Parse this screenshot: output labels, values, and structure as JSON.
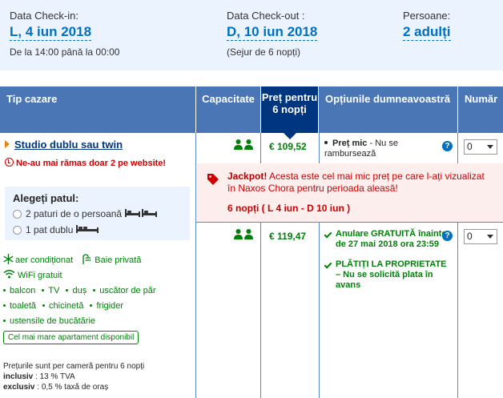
{
  "summary": {
    "checkin_label": "Data Check-in:",
    "checkin_value": "L, 4 iun 2018",
    "checkin_time": "De la 14:00 până la 00:00",
    "checkout_label": "Data Check-out :",
    "checkout_value": "D, 10 iun 2018",
    "stay": "(Sejur de 6 nopți)",
    "guests_label": "Persoane:",
    "guests_value": "2 adulți"
  },
  "table": {
    "headers": {
      "type": "Tip cazare",
      "capacity": "Capacitate",
      "price": "Preț pentru 6 nopți",
      "options": "Opțiunile dumneavoastră",
      "number": "Număr"
    }
  },
  "room": {
    "name": "Studio dublu sau twin",
    "scarcity": "Ne-au mai rămas doar 2 pe website!",
    "bed_title": "Alegeți patul:",
    "bed_options": [
      "2 paturi de o persoană",
      "1 pat dublu"
    ],
    "facilities_icon": [
      "aer condiționat",
      "Baie privată",
      "WiFi gratuit"
    ],
    "facilities": [
      "balcon",
      "TV",
      "duș",
      "uscător de păr",
      "toaletă",
      "chicinetă",
      "frigider",
      "ustensile de bucătărie"
    ],
    "badge": "Cel mai mare apartament disponibil",
    "prices_note_1": "Prețurile sunt per cameră pentru 6 nopți",
    "prices_note_2_bold": "inclusiv",
    "prices_note_2": " : 13 % TVA",
    "prices_note_3_bold": "exclusiv",
    "prices_note_3": " : 0,5 % taxă de oraș"
  },
  "offers": [
    {
      "price": "€ 109,52",
      "option_bold": "Preț mic",
      "option_rest": " - Nu se rambursează",
      "select_value": "0"
    },
    {
      "price": "€ 119,47",
      "option_1": "Anulare GRATUITĂ înainte de 27 mai 2018 ora 23:59",
      "option_2": "PLĂTIȚI LA PROPRIETATE – Nu se solicită plata în avans",
      "select_value": "0"
    }
  ],
  "jackpot": {
    "title": "Jackpot!",
    "text": " Acesta este cel mai mic preț pe care l-ați vizualizat în Naxos Chora pentru perioada aleasă!",
    "dates": "6 nopți ( L 4 iun - D 10 iun )"
  },
  "help_glyph": "?",
  "colors": {
    "brand_blue": "#003580",
    "header_blue": "#4b76b5",
    "link_blue": "#0071c2",
    "green": "#008009",
    "red": "#cc0000",
    "summary_bg": "#ebf3ff"
  }
}
